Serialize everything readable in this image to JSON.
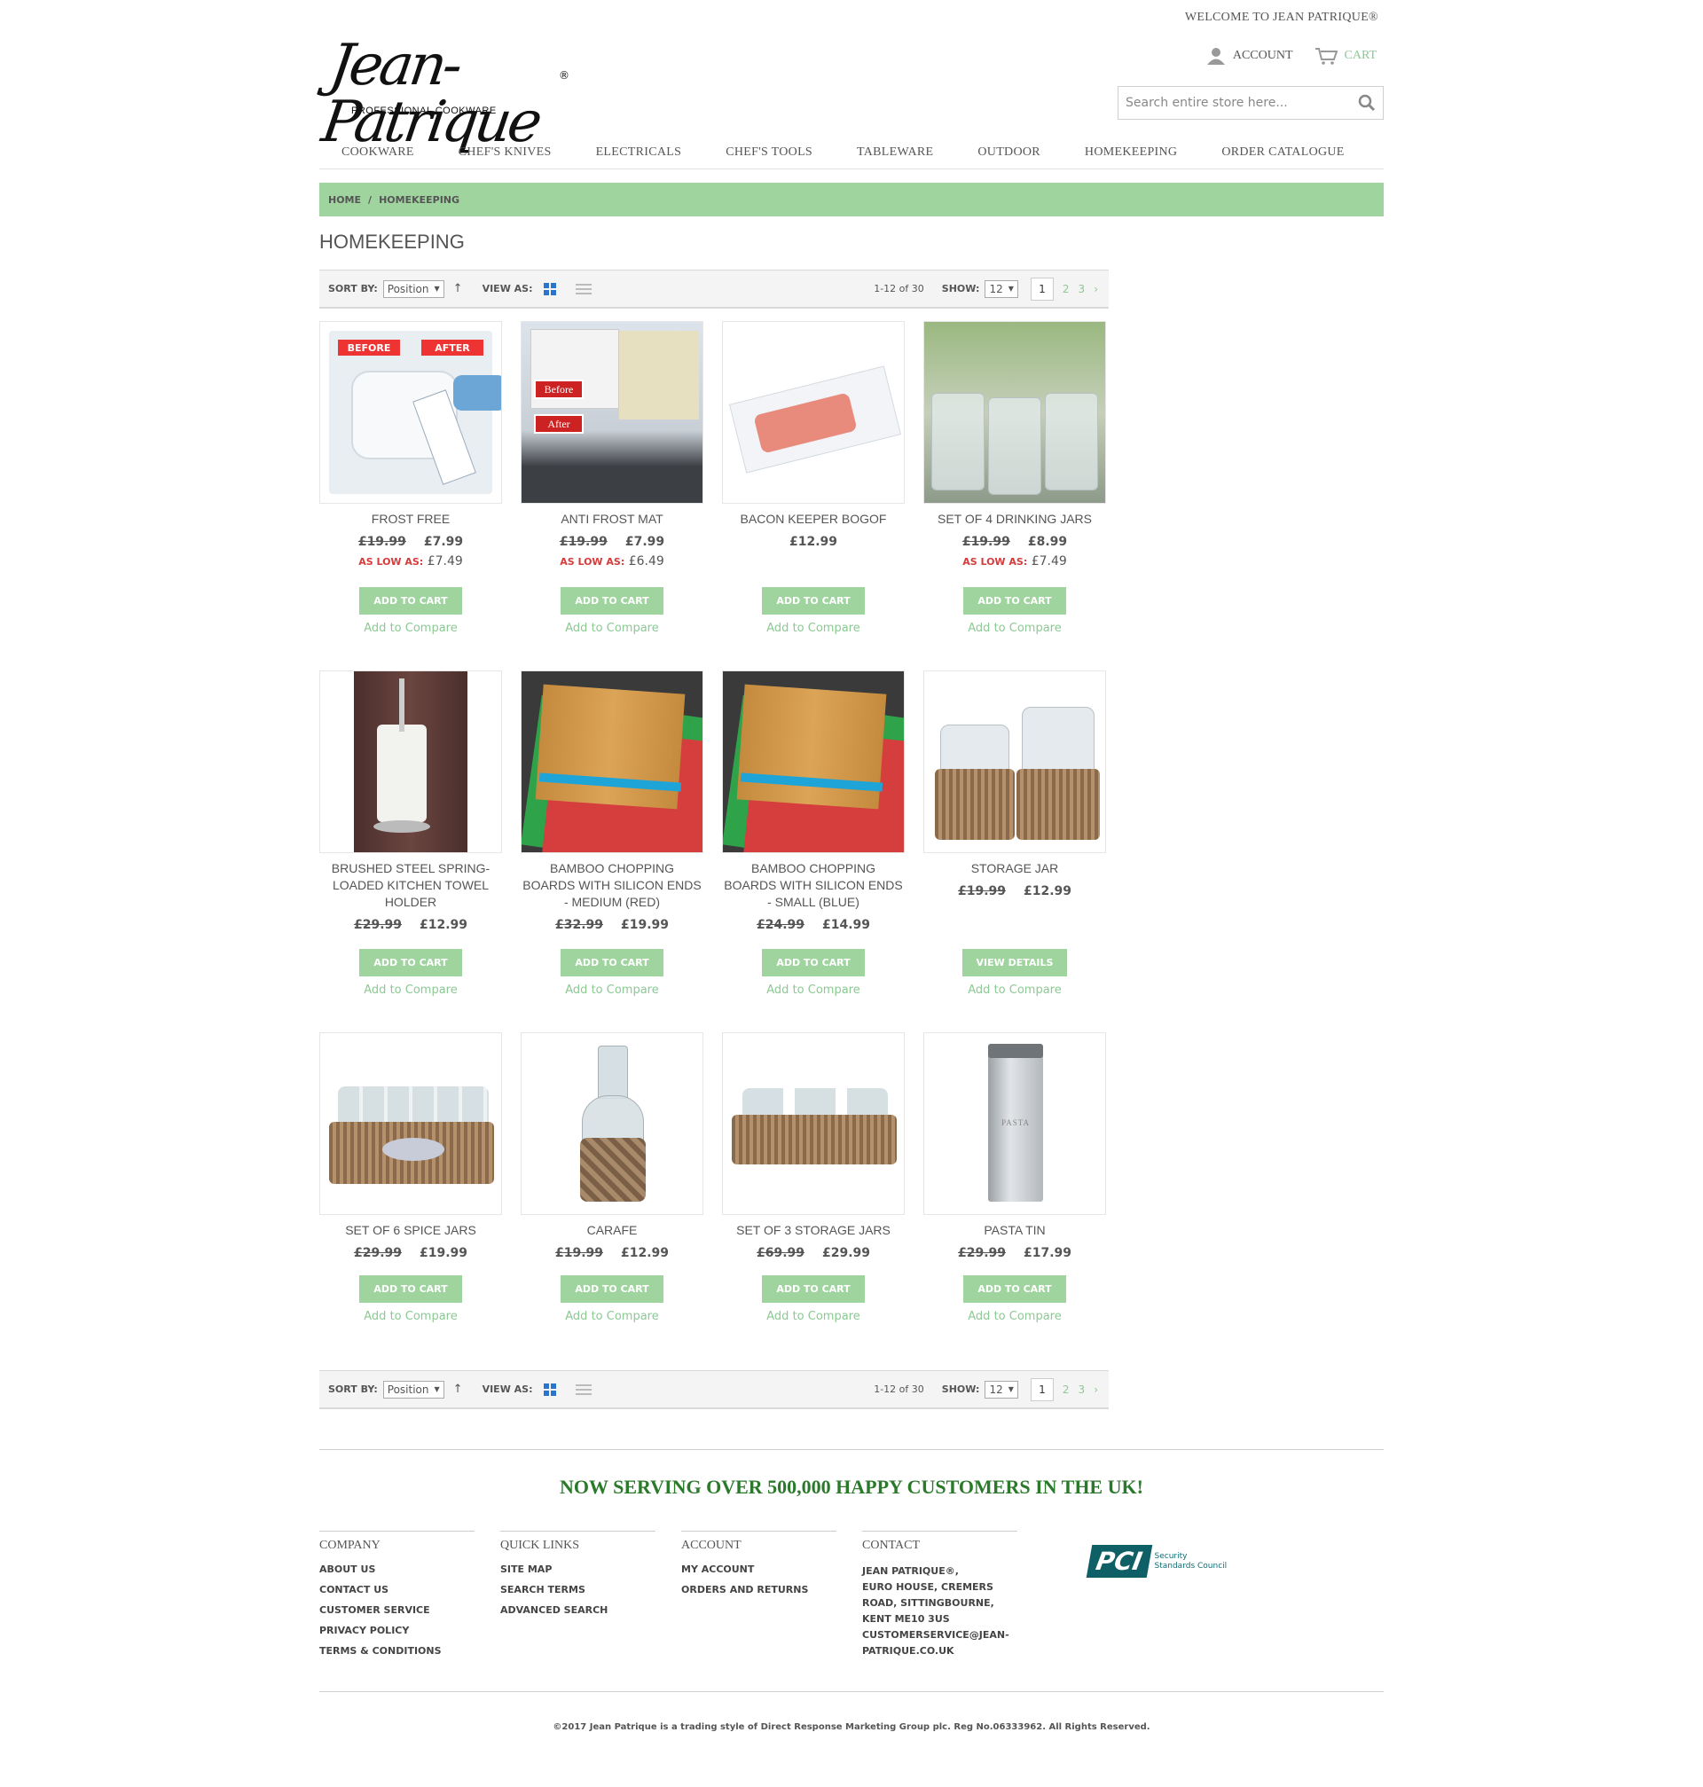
{
  "header": {
    "welcome": "WELCOME TO JEAN PATRIQUE®",
    "account_label": "ACCOUNT",
    "cart_label": "CART",
    "logo_text": "Jean-Patrique",
    "logo_reg": "®",
    "logo_sub": "PROFESSIONAL COOKWARE",
    "search_placeholder": "Search entire store here..."
  },
  "nav": [
    "COOKWARE",
    "CHEF'S KNIVES",
    "ELECTRICALS",
    "CHEF'S TOOLS",
    "TABLEWARE",
    "OUTDOOR",
    "HOMEKEEPING",
    "ORDER CATALOGUE"
  ],
  "breadcrumb": {
    "home": "HOME",
    "sep": "/",
    "current": "HOMEKEEPING"
  },
  "page_title": "HOMEKEEPING",
  "toolbar": {
    "sort_label": "SORT BY:",
    "sort_value": "Position",
    "view_label": "VIEW AS:",
    "count": "1-12 of 30",
    "show_label": "SHOW:",
    "show_value": "12",
    "pages": [
      "1",
      "2",
      "3"
    ],
    "next": "›"
  },
  "products": [
    {
      "name": "FROST FREE",
      "old": "£19.99",
      "price": "£7.99",
      "low_label": "AS LOW AS:",
      "low": "£7.49",
      "button": "ADD TO CART",
      "compare": "Add to Compare",
      "img_label_a": "BEFORE",
      "img_label_b": "AFTER"
    },
    {
      "name": "ANTI FROST MAT",
      "old": "£19.99",
      "price": "£7.99",
      "low_label": "AS LOW AS:",
      "low": "£6.49",
      "button": "ADD TO CART",
      "compare": "Add to Compare",
      "img_label_a": "Before",
      "img_label_b": "After"
    },
    {
      "name": "BACON KEEPER BOGOF",
      "old": "",
      "price": "£12.99",
      "low_label": "",
      "low": "",
      "button": "ADD TO CART",
      "compare": "Add to Compare"
    },
    {
      "name": "SET OF 4 DRINKING JARS",
      "old": "£19.99",
      "price": "£8.99",
      "low_label": "AS LOW AS:",
      "low": "£7.49",
      "button": "ADD TO CART",
      "compare": "Add to Compare"
    },
    {
      "name": "BRUSHED STEEL SPRING-LOADED KITCHEN TOWEL HOLDER",
      "old": "£29.99",
      "price": "£12.99",
      "low_label": "",
      "low": "",
      "button": "ADD TO CART",
      "compare": "Add to Compare"
    },
    {
      "name": "BAMBOO CHOPPING BOARDS WITH SILICON ENDS - MEDIUM (RED)",
      "old": "£32.99",
      "price": "£19.99",
      "low_label": "",
      "low": "",
      "button": "ADD TO CART",
      "compare": "Add to Compare"
    },
    {
      "name": "BAMBOO CHOPPING BOARDS WITH SILICON ENDS - SMALL (BLUE)",
      "old": "£24.99",
      "price": "£14.99",
      "low_label": "",
      "low": "",
      "button": "ADD TO CART",
      "compare": "Add to Compare"
    },
    {
      "name": "STORAGE JAR",
      "old": "£19.99",
      "price": "£12.99",
      "low_label": "",
      "low": "",
      "button": "VIEW DETAILS",
      "compare": "Add to Compare"
    },
    {
      "name": "SET OF 6 SPICE JARS",
      "old": "£29.99",
      "price": "£19.99",
      "low_label": "",
      "low": "",
      "button": "ADD TO CART",
      "compare": "Add to Compare"
    },
    {
      "name": "CARAFE",
      "old": "£19.99",
      "price": "£12.99",
      "low_label": "",
      "low": "",
      "button": "ADD TO CART",
      "compare": "Add to Compare"
    },
    {
      "name": "SET OF 3 STORAGE JARS",
      "old": "£69.99",
      "price": "£29.99",
      "low_label": "",
      "low": "",
      "button": "ADD TO CART",
      "compare": "Add to Compare"
    },
    {
      "name": "PASTA TIN",
      "old": "£29.99",
      "price": "£17.99",
      "low_label": "",
      "low": "",
      "button": "ADD TO CART",
      "compare": "Add to Compare",
      "img_label_a": "PASTA"
    }
  ],
  "footer": {
    "slogan": "NOW SERVING OVER 500,000 HAPPY CUSTOMERS IN THE UK!",
    "company": {
      "title": "COMPANY",
      "links": [
        "ABOUT US",
        "CONTACT US",
        "CUSTOMER SERVICE",
        "PRIVACY POLICY",
        "TERMS & CONDITIONS"
      ]
    },
    "quick": {
      "title": "QUICK LINKS",
      "links": [
        "SITE MAP",
        "SEARCH TERMS",
        "ADVANCED SEARCH"
      ]
    },
    "account": {
      "title": "ACCOUNT",
      "links": [
        "MY ACCOUNT",
        "ORDERS AND RETURNS"
      ]
    },
    "contact": {
      "title": "CONTACT",
      "lines": [
        "JEAN PATRIQUE®,",
        "EURO HOUSE, CREMERS",
        "ROAD, SITTINGBOURNE,",
        "KENT ME10 3US",
        "CUSTOMERSERVICE@JEAN-",
        "PATRIQUE.CO.UK"
      ]
    },
    "pci_logo": "PCI",
    "pci_line1": "Security",
    "pci_line2": "Standards Council",
    "copyright": "©2017 Jean Patrique is a trading style of Direct Response Marketing Group plc. Reg No.06333962. All Rights Reserved."
  },
  "colors": {
    "accent_green": "#9fd49f",
    "link_green": "#8cc994",
    "sale_red": "#d63b3b",
    "slogan_green": "#2b7a2b"
  }
}
